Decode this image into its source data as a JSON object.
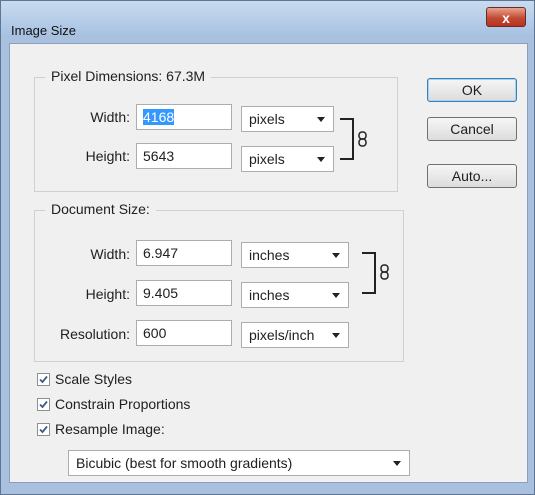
{
  "window": {
    "title": "Image Size",
    "close_glyph": "x"
  },
  "buttons": {
    "ok": "OK",
    "cancel": "Cancel",
    "auto": "Auto..."
  },
  "pixel_dimensions": {
    "legend": "Pixel Dimensions:",
    "total": "67.3M",
    "width": {
      "label": "Width:",
      "value": "4168",
      "unit": "pixels"
    },
    "height": {
      "label": "Height:",
      "value": "5643",
      "unit": "pixels"
    }
  },
  "document_size": {
    "legend": "Document Size:",
    "width": {
      "label": "Width:",
      "value": "6.947",
      "unit": "inches"
    },
    "height": {
      "label": "Height:",
      "value": "9.405",
      "unit": "inches"
    },
    "resolution": {
      "label": "Resolution:",
      "value": "600",
      "unit": "pixels/inch"
    }
  },
  "options": {
    "scale_styles": {
      "label": "Scale Styles",
      "checked": true
    },
    "constrain_proportions": {
      "label": "Constrain Proportions",
      "checked": true
    },
    "resample_image": {
      "label": "Resample Image:",
      "checked": true
    },
    "resample_method": "Bicubic (best for smooth gradients)"
  },
  "icons": {
    "close": "close-icon",
    "link": "chain-link-icon",
    "dropdown": "chevron-down-icon",
    "check": "checkmark-icon"
  },
  "colors": {
    "selection": "#3399ff",
    "title_bar": "#a8c2e2",
    "close_button": "#c24b35"
  }
}
